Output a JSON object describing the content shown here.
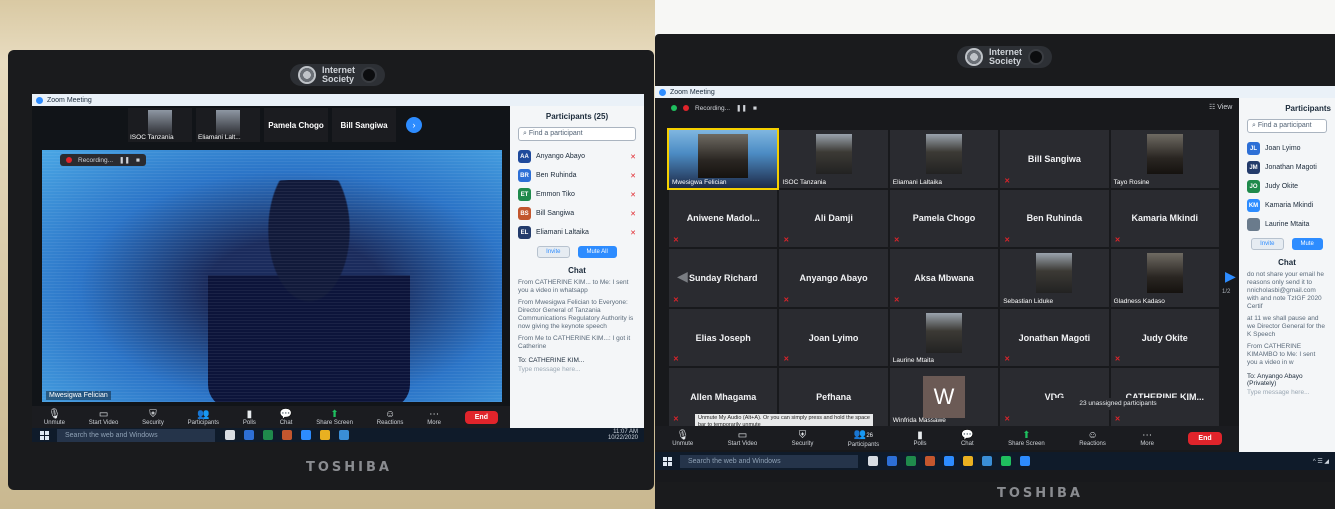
{
  "left": {
    "window_title": "Zoom Meeting",
    "top_tiles": [
      {
        "label": "ISOC Tanzania",
        "type": "video"
      },
      {
        "label": "Eliamani Lalt...",
        "type": "video"
      },
      {
        "label": "Pamela Chogo",
        "type": "name"
      },
      {
        "label": "Bill Sangiwa",
        "type": "name"
      }
    ],
    "recording_label": "Recording...",
    "speaker_label": "Mwesigwa Felician",
    "participants_header": "Participants (25)",
    "find_placeholder": "Find a participant",
    "participants": [
      {
        "initials": "AA",
        "name": "Anyango Abayo",
        "color": "#1f4a9c"
      },
      {
        "initials": "BR",
        "name": "Ben Ruhinda",
        "color": "#2d6fd6"
      },
      {
        "initials": "ET",
        "name": "Emmon Tiko",
        "color": "#1f8a4c"
      },
      {
        "initials": "BS",
        "name": "Bill Sangiwa",
        "color": "#c2562e"
      },
      {
        "initials": "EL",
        "name": "Eliamani Laltaika",
        "color": "#233b6b"
      }
    ],
    "invite_label": "Invite",
    "mute_all_label": "Mute All",
    "chat_header": "Chat",
    "chat_messages": [
      "From CATHERINE KIM... to Me: I sent you a video in whatsapp",
      "From Mwesigwa Felician to Everyone: Director General of Tanzania Communications Regulatory Authority is now giving the keynote speech",
      "From Me to CATHERINE KIM...: I got it Catherine"
    ],
    "chat_to_label": "To: CATHERINE KIM...",
    "chat_input_placeholder": "Type message here...",
    "toolbar": [
      "Unmute",
      "Start Video",
      "Security",
      "Participants",
      "Polls",
      "Chat",
      "Share Screen",
      "Reactions",
      "More"
    ],
    "end_label": "End",
    "taskbar_search": "Search the web and Windows",
    "tray_time": "11:07 AM",
    "tray_date": "10/22/2020",
    "brand": "TOSHIBA",
    "isoc_line1": "Internet",
    "isoc_line2": "Society"
  },
  "right": {
    "window_title": "Zoom Meeting",
    "recording_label": "Recording...",
    "view_label": "View",
    "page_indicator": "1/2",
    "tiles": [
      {
        "label": "Mwesigwa Felician",
        "type": "video-main"
      },
      {
        "label": "ISOC Tanzania",
        "type": "video"
      },
      {
        "label": "Eliamani Laltaika",
        "type": "video"
      },
      {
        "label": "Bill Sangiwa",
        "type": "name"
      },
      {
        "label": "Tayo Rosine",
        "type": "video-dark"
      },
      {
        "label": "Aniwene Madol...",
        "type": "name"
      },
      {
        "label": "Ali Damji",
        "type": "name"
      },
      {
        "label": "Pamela Chogo",
        "type": "name"
      },
      {
        "label": "Ben Ruhinda",
        "type": "name"
      },
      {
        "label": "Kamaria Mkindi",
        "type": "name"
      },
      {
        "label": "Sunday Richard",
        "type": "name"
      },
      {
        "label": "Anyango Abayo",
        "type": "name"
      },
      {
        "label": "Aksa Mbwana",
        "type": "name"
      },
      {
        "label": "Sebastian Liduke",
        "type": "video"
      },
      {
        "label": "Gladness Kadaso",
        "type": "video-dark"
      },
      {
        "label": "Elias Joseph",
        "type": "name"
      },
      {
        "label": "Joan Lyimo",
        "type": "name"
      },
      {
        "label": "Laurine Mtaita",
        "type": "video"
      },
      {
        "label": "Jonathan Magoti",
        "type": "name"
      },
      {
        "label": "Judy Okite",
        "type": "name"
      },
      {
        "label": "Allen Mhagama",
        "type": "name"
      },
      {
        "label": "Pefhana",
        "type": "name"
      },
      {
        "label": "Winfrida Massawe",
        "type": "avatar",
        "letter": "W"
      },
      {
        "label": "VDG",
        "type": "name"
      },
      {
        "label": "CATHERINE KIM...",
        "type": "name"
      }
    ],
    "unassigned_label": "23 unassigned participants",
    "participants_header": "Participants",
    "find_placeholder": "Find a participant",
    "participants": [
      {
        "initials": "JL",
        "name": "Joan Lyimo",
        "color": "#2d6fd6"
      },
      {
        "initials": "JM",
        "name": "Jonathan Magoti",
        "color": "#233b6b"
      },
      {
        "initials": "JO",
        "name": "Judy Okite",
        "color": "#1f8a4c"
      },
      {
        "initials": "KM",
        "name": "Kamaria Mkindi",
        "color": "#2d8cff"
      },
      {
        "initials": "",
        "name": "Laurine Mtaita",
        "color": "#6a7b8c"
      }
    ],
    "invite_label": "Invite",
    "mute_all_label": "Mute",
    "chat_header": "Chat",
    "chat_messages": [
      "do not share your email he reasons only send it to nnicholasbi@gmail.com with and note TzIGF 2020 Certif",
      "at 11 we shall pause and we Director General for the K Speech",
      "From CATHERINE KIMAMBO to Me: I sent you a video in w"
    ],
    "chat_to_label": "To: Anyango Abayo (Privately)",
    "chat_input_placeholder": "Type message here...",
    "unmute_tooltip": "Unmute My Audio (Alt+A). Or you can simply press and hold the space bar to temporarily unmute",
    "toolbar": [
      "Unmute",
      "Start Video",
      "Security",
      "Participants",
      "Polls",
      "Chat",
      "Share Screen",
      "Reactions",
      "More"
    ],
    "participant_count": "26",
    "end_label": "End",
    "taskbar_search": "Search the web and Windows",
    "brand": "TOSHIBA",
    "isoc_line1": "Internet",
    "isoc_line2": "Society"
  }
}
